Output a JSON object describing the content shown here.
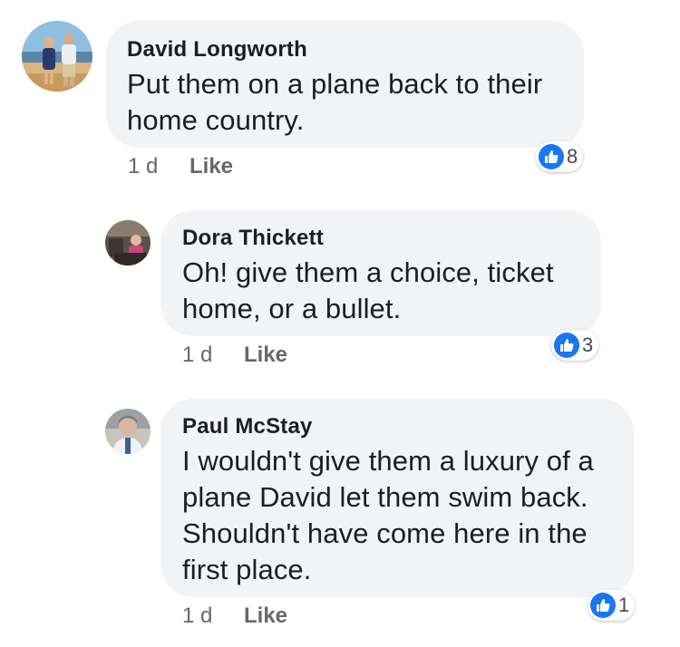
{
  "comments": [
    {
      "author": "David Longworth",
      "lines": [
        "Put them on a plane back to their",
        "home country."
      ],
      "time": "1 d",
      "like_label": "Like",
      "reaction_count": "8"
    },
    {
      "author": "Dora Thickett",
      "lines": [
        "Oh!  give them a choice, ticket",
        "home, or a bullet."
      ],
      "time": "1 d",
      "like_label": "Like",
      "reaction_count": "3"
    },
    {
      "author": "Paul McStay",
      "lines": [
        "I wouldn't give them a luxury of a",
        "plane David let them swim back.",
        "Shouldn't have come here in the",
        "first place."
      ],
      "time": "1 d",
      "like_label": "Like",
      "reaction_count": "1"
    }
  ],
  "colors": {
    "bubble": "#f2f3f5",
    "like_blue": "#1877f2",
    "meta_gray": "#65676b",
    "text": "#1c1e21"
  }
}
